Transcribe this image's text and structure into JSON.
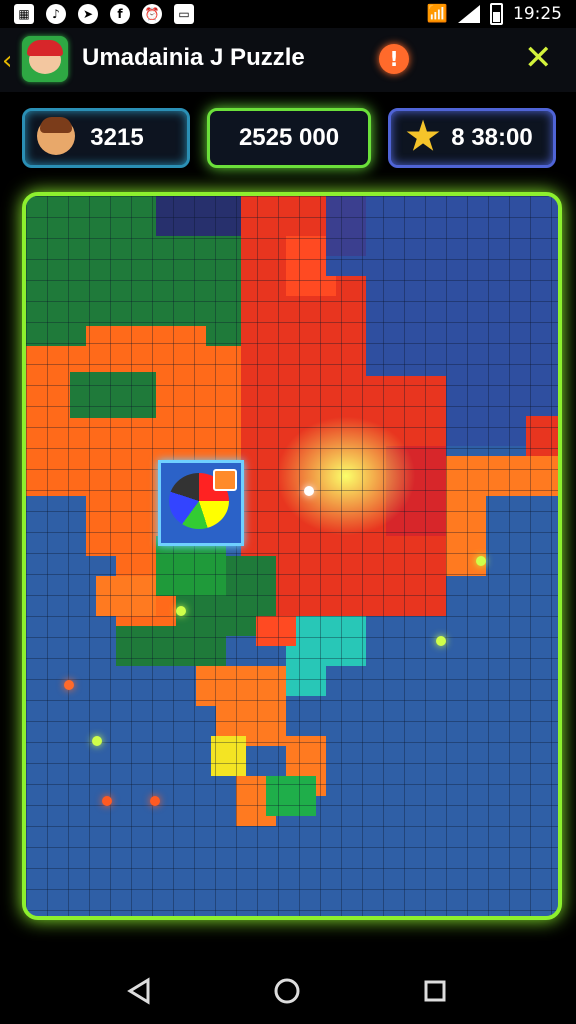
{
  "status_bar": {
    "time": "19:25",
    "left_icons": [
      "jp-icon",
      "tiktok-icon",
      "location-icon",
      "facebook-icon",
      "alarm-icon",
      "card-icon"
    ],
    "right_icons": [
      "wifi-icon",
      "signal-icon",
      "battery-icon"
    ]
  },
  "header": {
    "title": "Umadainia J Puzzle",
    "alert_label": "!"
  },
  "stats": {
    "player_score": "3215",
    "center_score": "2525  000",
    "coins": "8 38:00"
  },
  "board": {
    "colors": [
      "#2f5fa6",
      "#1f7a3a",
      "#ff6a1a",
      "#e8351f",
      "#f4e423",
      "#28c7b7",
      "#3b3f8f"
    ]
  },
  "nav": {
    "back_label": "◁",
    "home_label": "○",
    "recent_label": "□"
  }
}
